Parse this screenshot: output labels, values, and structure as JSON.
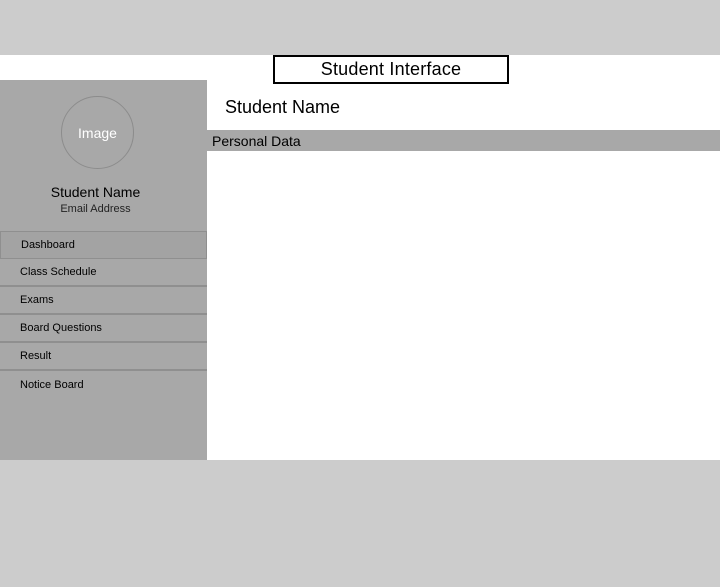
{
  "header": {
    "title": "Student Interface"
  },
  "sidebar": {
    "avatar_label": "Image",
    "student_name": "Student Name",
    "email": "Email Address",
    "items": [
      {
        "label": "Dashboard"
      },
      {
        "label": "Class Schedule"
      },
      {
        "label": "Exams"
      },
      {
        "label": "Board Questions"
      },
      {
        "label": "Result"
      },
      {
        "label": "Notice Board"
      }
    ]
  },
  "main": {
    "student_name": "Student Name",
    "section_title": "Personal Data"
  }
}
